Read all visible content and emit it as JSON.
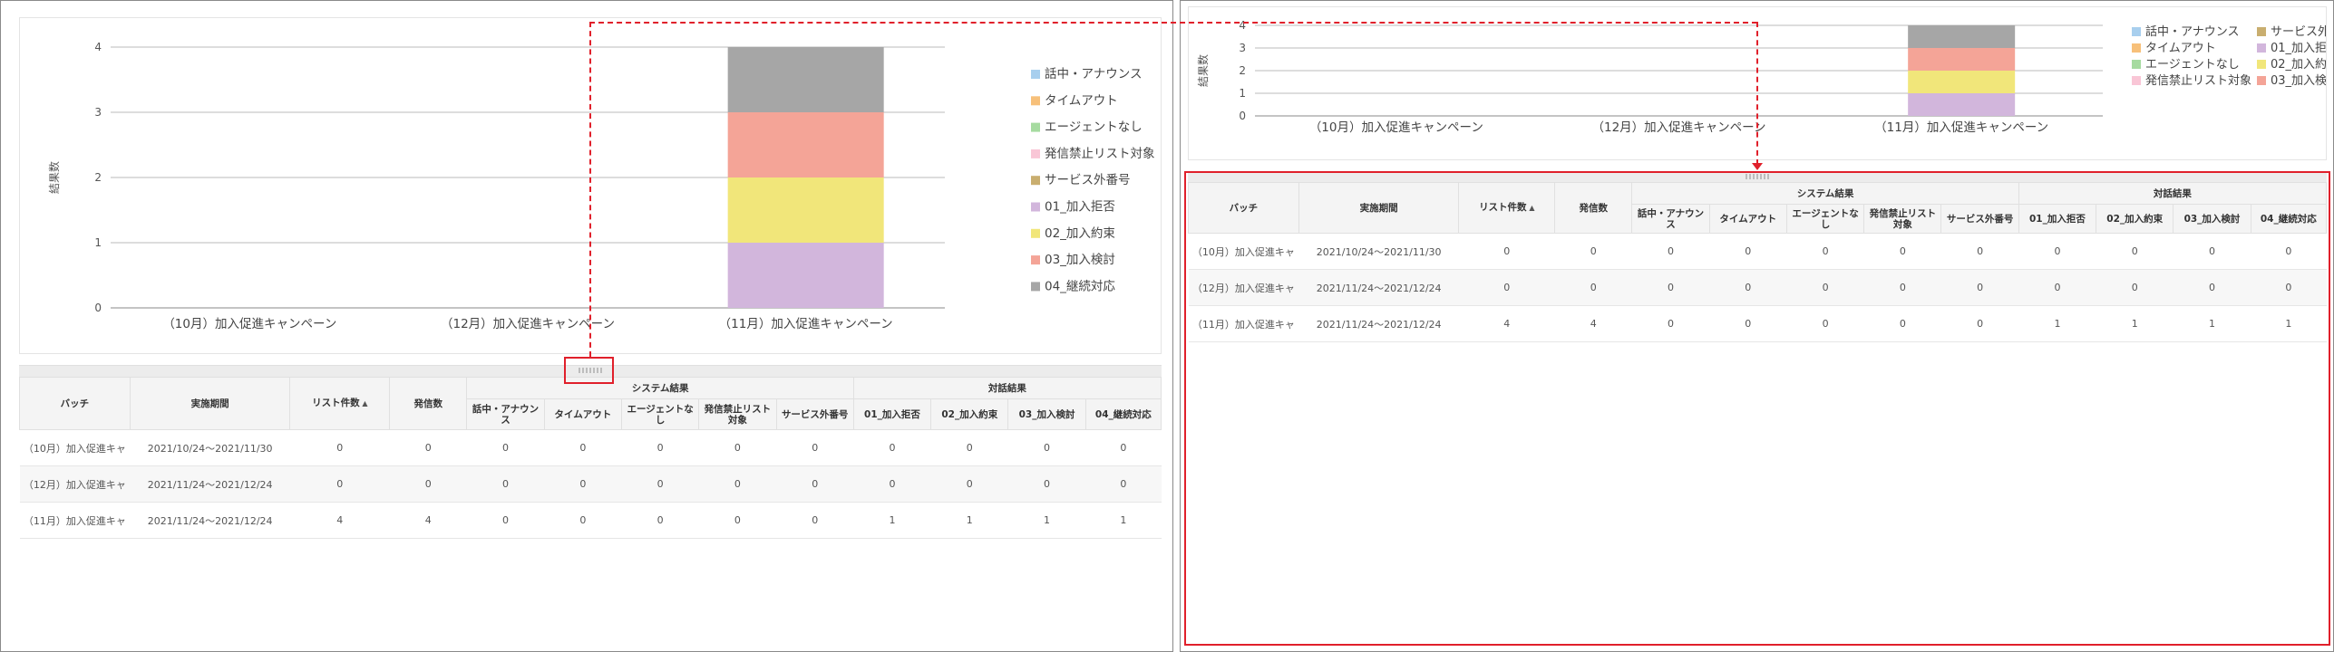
{
  "chart": {
    "y_label": "結果数",
    "y_ticks": [
      "0",
      "1",
      "2",
      "3",
      "4"
    ],
    "categories": [
      "（10月）加入促進キャンペーン",
      "（12月）加入促進キャンペーン",
      "（11月）加入促進キャンペーン"
    ]
  },
  "chart_data": {
    "type": "bar",
    "stacked": true,
    "ylabel": "結果数",
    "ylim": [
      0,
      4
    ],
    "categories": [
      "（10月）加入促進キャンペーン",
      "（12月）加入促進キャンペーン",
      "（11月）加入促進キャンペーン"
    ],
    "series": [
      {
        "name": "話中・アナウンス",
        "color": "#a8cfee",
        "values": [
          0,
          0,
          0
        ]
      },
      {
        "name": "タイムアウト",
        "color": "#f7c07a",
        "values": [
          0,
          0,
          0
        ]
      },
      {
        "name": "エージェントなし",
        "color": "#a6dba0",
        "values": [
          0,
          0,
          0
        ]
      },
      {
        "name": "発信禁止リスト対象",
        "color": "#f9c6d6",
        "values": [
          0,
          0,
          0
        ]
      },
      {
        "name": "サービス外番号",
        "color": "#c9ae6f",
        "values": [
          0,
          0,
          0
        ]
      },
      {
        "name": "01_加入拒否",
        "color": "#d2b6dc",
        "values": [
          0,
          0,
          1
        ]
      },
      {
        "name": "02_加入約束",
        "color": "#f1e67a",
        "values": [
          0,
          0,
          1
        ]
      },
      {
        "name": "03_加入検討",
        "color": "#f4a497",
        "values": [
          0,
          0,
          1
        ]
      },
      {
        "name": "04_継続対応",
        "color": "#a6a6a6",
        "values": [
          0,
          0,
          1
        ]
      }
    ],
    "legend": "right"
  },
  "table": {
    "group_system": "システム結果",
    "group_dialog": "対話結果",
    "headers": {
      "batch": "バッチ",
      "period": "実施期間",
      "list_count": "リスト件数",
      "sort_mark": "▲",
      "calls": "発信数",
      "sub": [
        "話中・アナウンス",
        "タイムアウト",
        "エージェントなし",
        "発信禁止リスト対象",
        "サービス外番号",
        "01_加入拒否",
        "02_加入約束",
        "03_加入検討",
        "04_継続対応"
      ]
    },
    "rows": [
      {
        "batch": "（10月）加入促進キャ",
        "period": "2021/10/24～2021/11/30",
        "cells": [
          "0",
          "0",
          "0",
          "0",
          "0",
          "0",
          "0",
          "0",
          "0",
          "0",
          "0"
        ]
      },
      {
        "batch": "（12月）加入促進キャ",
        "period": "2021/11/24～2021/12/24",
        "cells": [
          "0",
          "0",
          "0",
          "0",
          "0",
          "0",
          "0",
          "0",
          "0",
          "0",
          "0"
        ]
      },
      {
        "batch": "（11月）加入促進キャ",
        "period": "2021/11/24～2021/12/24",
        "cells": [
          "4",
          "4",
          "0",
          "0",
          "0",
          "0",
          "0",
          "1",
          "1",
          "1",
          "1"
        ]
      }
    ]
  }
}
